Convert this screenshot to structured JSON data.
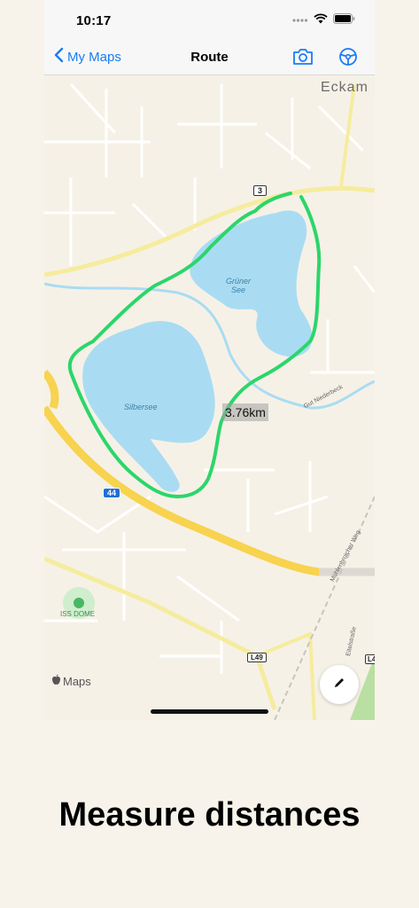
{
  "status_bar": {
    "time": "10:17"
  },
  "nav": {
    "back_label": "My Maps",
    "title": "Route"
  },
  "map": {
    "place_labels": {
      "eckam": "Eckam",
      "gruner_see": "Grüner\nSee",
      "silbersee": "Silbersee",
      "gut_niederbeck": "Gut Niederbeck",
      "muhlenbroicher_weg": "Mühlenbroicher Weg",
      "eitelstrasse": "Eitelstraße",
      "iss_dome": "ISS DOME"
    },
    "road_shields": {
      "r3": "3",
      "r44": "44",
      "l49": "L49",
      "l4": "L4"
    },
    "distance": "3.76km",
    "attribution": "Maps"
  },
  "caption": "Measure distances",
  "colors": {
    "route": "#2bd66a",
    "water": "#a9dcf2",
    "highway": "#f7d34f",
    "accent": "#1a7cf4"
  }
}
